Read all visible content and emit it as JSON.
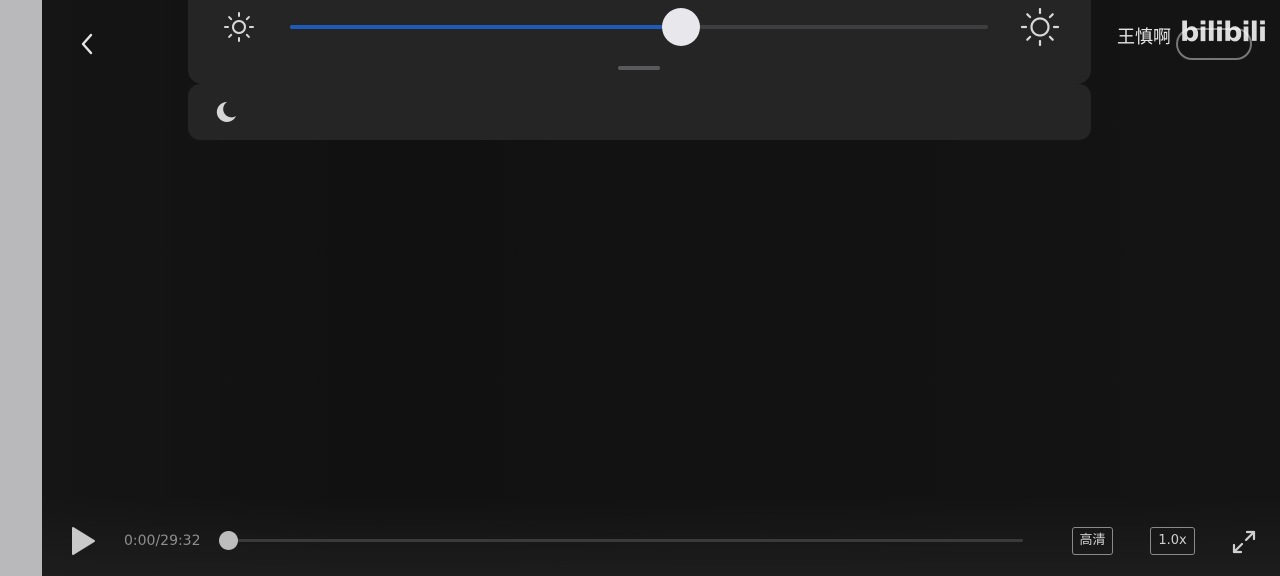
{
  "header": {
    "uploader_name": "王慎啊",
    "watermark": "bilibili"
  },
  "brightness": {
    "level": 0.56
  },
  "player": {
    "time": "0:00/29:32",
    "progress": 0.0,
    "quality_label": "高清",
    "speed_label": "1.0x"
  },
  "icons": {
    "back": "chevron-left-icon",
    "brightness_low": "sun-small-icon",
    "brightness_high": "sun-large-icon",
    "night_mode": "moon-icon",
    "play": "play-icon",
    "fullscreen": "fullscreen-icon"
  },
  "colors": {
    "slider_accent": "#1e5bb8",
    "panel_bg": "#252526",
    "video_bg": "#121212"
  }
}
